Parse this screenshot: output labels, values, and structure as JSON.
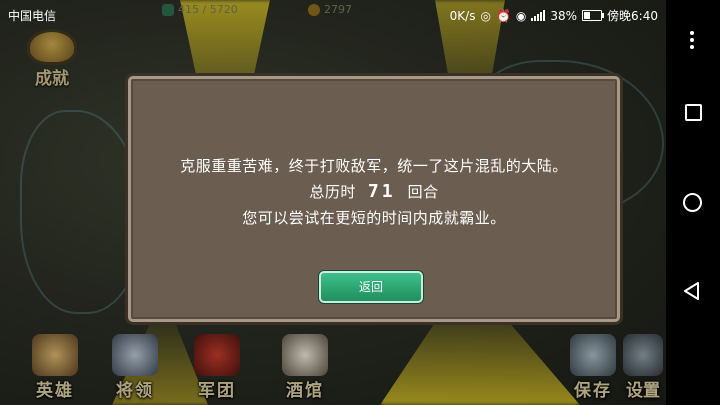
{
  "status_bar": {
    "carrier": "中国电信",
    "speed": "0K/s",
    "battery": "38%",
    "battery_level": 0.38,
    "time": "傍晚6:40"
  },
  "resources": {
    "clovers": "415 / 5720",
    "gold": "2797"
  },
  "achievements_label": "成就",
  "bottom_nav": {
    "heroes": "英雄",
    "generals": "将领",
    "legion": "军团",
    "tavern": "酒馆",
    "save": "保存",
    "settings": "设置"
  },
  "dialog": {
    "line1": "克服重重苦难，终于打败敌军，统一了这片混乱的大陆。",
    "turns_prefix": "总历时",
    "turns_value": "71",
    "turns_suffix": "回合",
    "line3": "您可以尝试在更短的时间内成就霸业。",
    "back_label": "返回"
  },
  "colors": {
    "dialog_bg": "#6b5e50",
    "button_green": "#2aa872",
    "highlight_yellow": "#f0d728"
  }
}
